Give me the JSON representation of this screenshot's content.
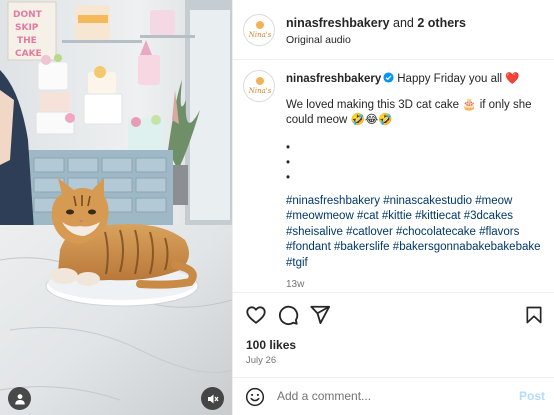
{
  "header": {
    "username": "ninasfreshbakery",
    "and_text": " and ",
    "others": "2 others",
    "audio": "Original audio"
  },
  "media": {
    "sign_text": [
      "DONT",
      "SKIP",
      "THE",
      "CAKE"
    ],
    "logo_text": "Nina's"
  },
  "caption": {
    "username": "ninasfreshbakery",
    "headline": "Happy Friday you all ❤️",
    "body": "We loved making this 3D cat cake 🎂 if only she could meow 🤣😂🤣",
    "bullets": [
      "•",
      "•",
      "•"
    ],
    "hashtags": [
      "#ninasfreshbakery",
      "#ninascakestudio",
      "#meow",
      "#meowmeow",
      "#cat",
      "#kittie",
      "#kittiecat",
      "#3dcakes",
      "#sheisalive",
      "#catlover",
      "#chocolatecake",
      "#flavors",
      "#fondant",
      "#bakerslife",
      "#bakersgonnabakebakebake",
      "#tgif"
    ],
    "time": "13w"
  },
  "engagement": {
    "likes": "100 likes",
    "date": "July 26"
  },
  "comment_box": {
    "placeholder": "Add a comment...",
    "post_label": "Post"
  },
  "icons": {
    "like": "heart-icon",
    "comment": "comment-icon",
    "share": "share-icon",
    "save": "bookmark-icon",
    "emoji": "emoji-icon",
    "verified": "verified-badge-icon",
    "user_tags": "user-tag-icon",
    "mute": "muted-speaker-icon"
  },
  "colors": {
    "link": "#00376b",
    "verified": "#0095f6",
    "post_button_disabled": "#b3dbff",
    "secondary_text": "#737373"
  }
}
